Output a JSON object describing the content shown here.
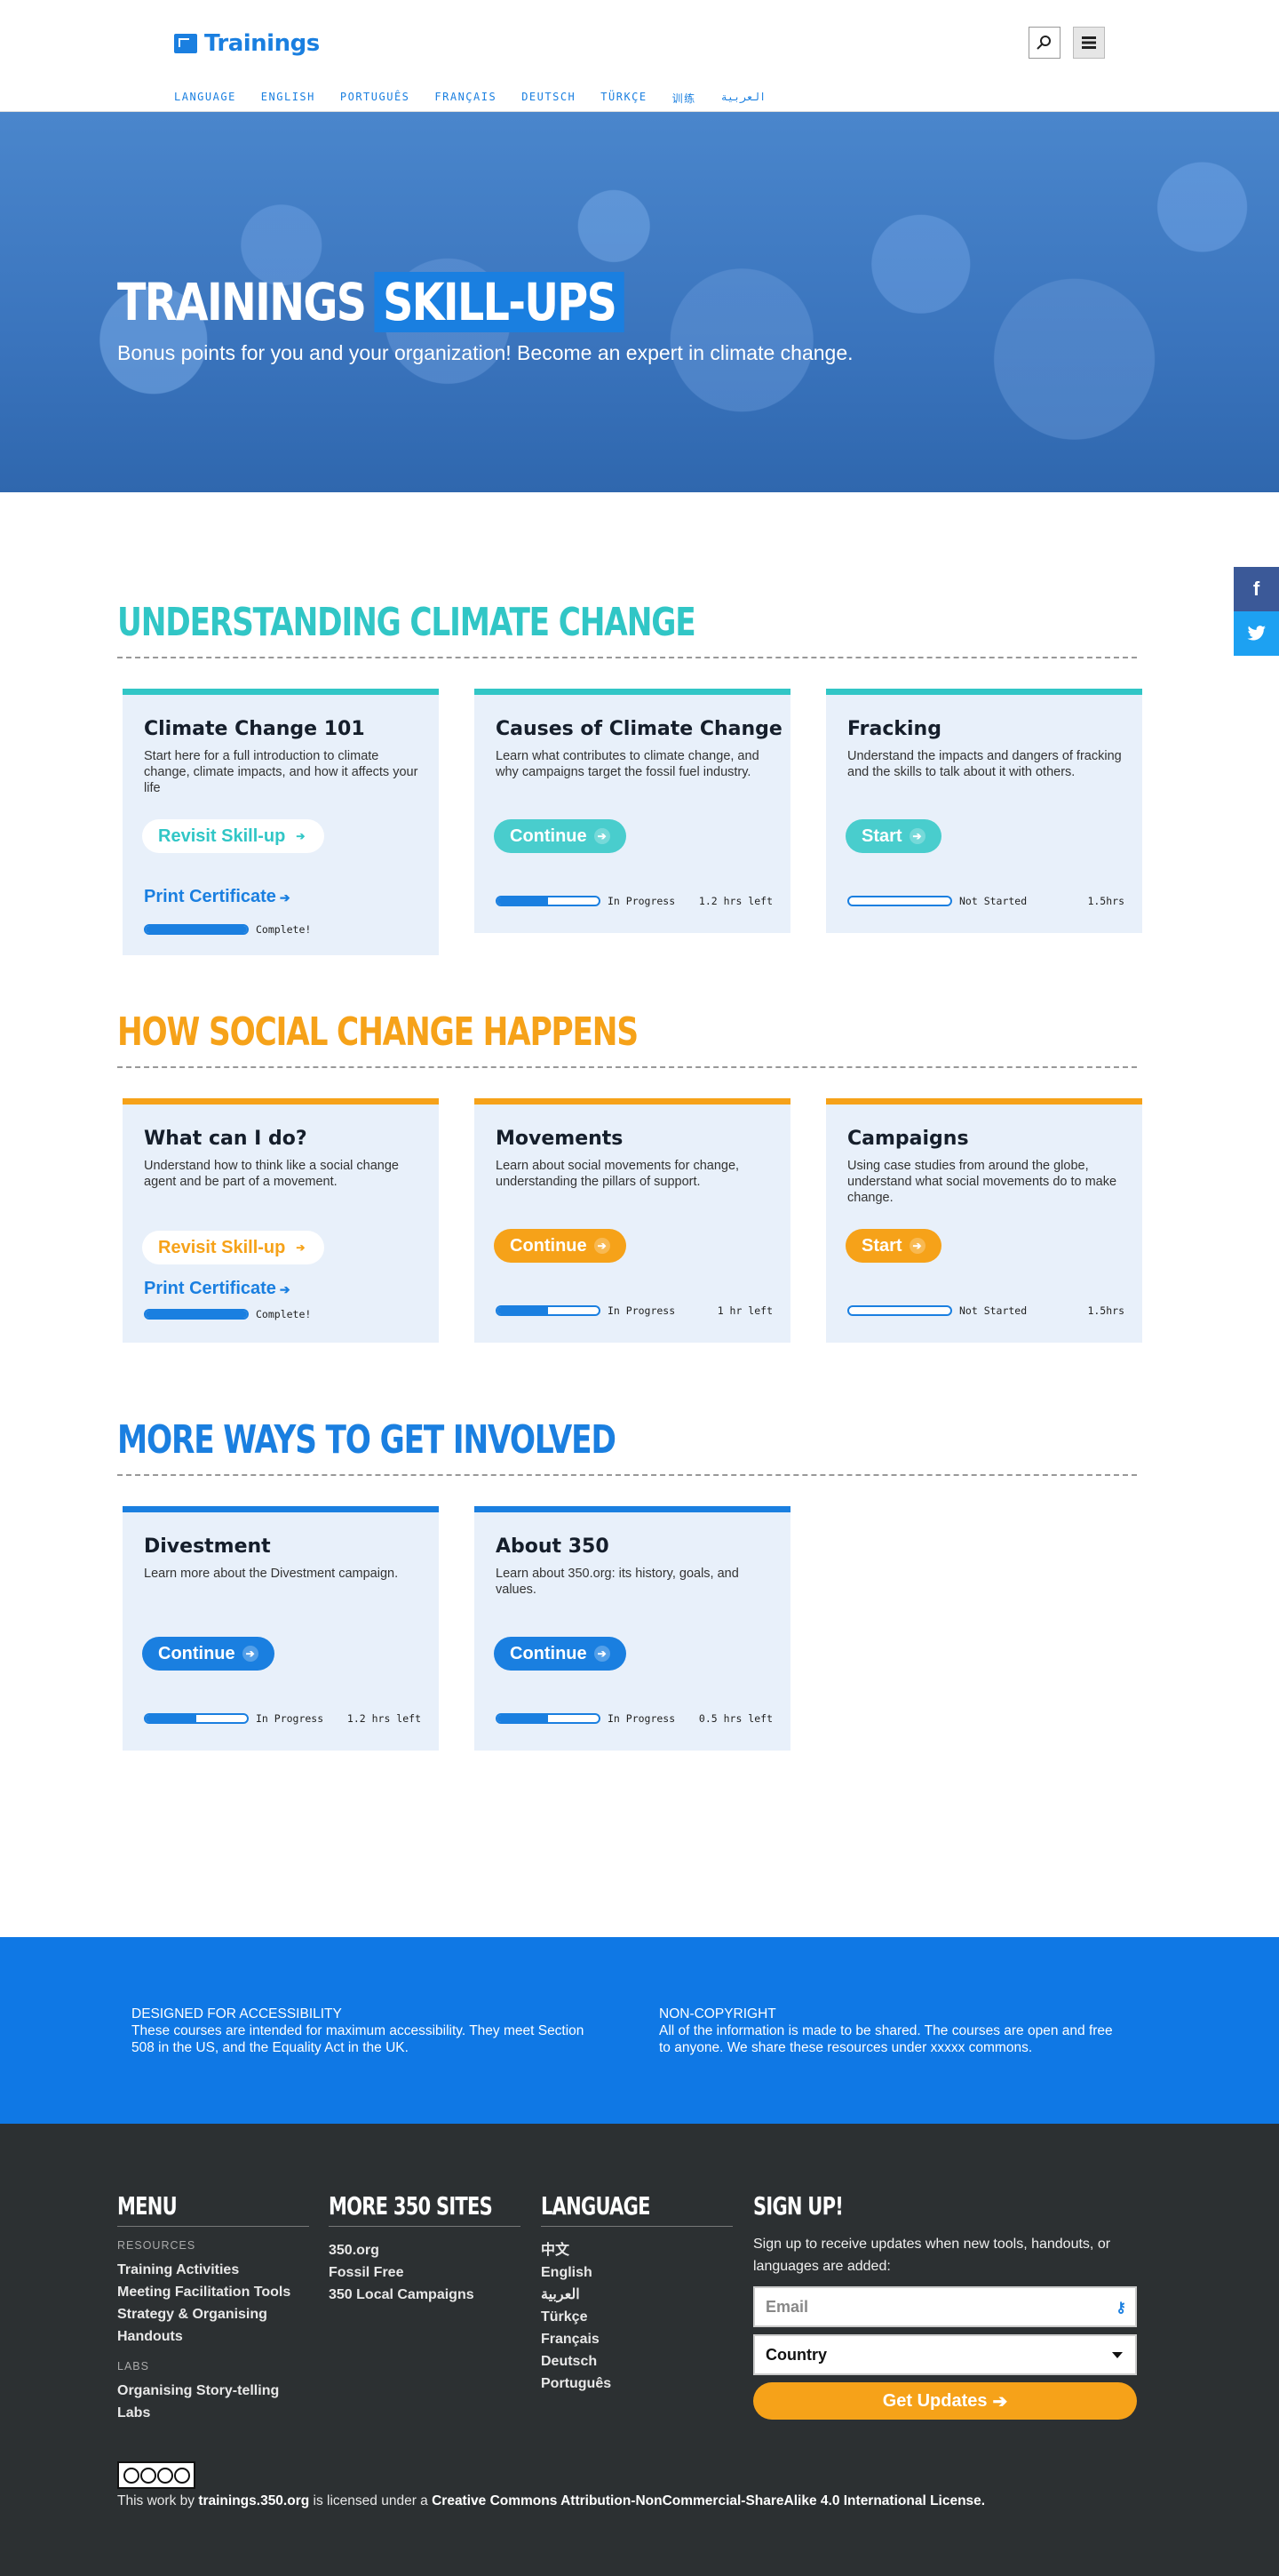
{
  "header": {
    "logo_text": "Trainings",
    "lang_items": [
      "LANGUAGE",
      "ENGLISH",
      "PORTUGUÊS",
      "FRANÇAIS",
      "DEUTSCH",
      "TÜRKÇE",
      "训练",
      "العربية"
    ]
  },
  "hero": {
    "title_plain": "TRAININGS",
    "title_highlight": "SKILL-UPS",
    "subtitle": "Bonus points for you and your organization! Become an expert in climate change."
  },
  "sections": [
    {
      "title": "UNDERSTANDING CLIMATE CHANGE",
      "cards": [
        {
          "title": "Climate Change 101",
          "desc": "Start here for a full introduction to climate change, climate impacts, and how it affects your life",
          "button": "Revisit Skill-up",
          "cert": "Print Certificate",
          "progress": 1.0,
          "status": "Complete!",
          "time": ""
        },
        {
          "title": "Causes of Climate Change",
          "desc": "Learn what contributes to climate change, and why campaigns target the fossil fuel industry.",
          "button": "Continue",
          "cert": "",
          "progress": 0.5,
          "status": "In Progress",
          "time": "1.2 hrs left"
        },
        {
          "title": "Fracking",
          "desc": "Understand the impacts and dangers of fracking and the skills to talk about it with others.",
          "button": "Start",
          "cert": "",
          "progress": 0.0,
          "status": "Not Started",
          "time": "1.5hrs"
        }
      ]
    },
    {
      "title": "HOW SOCIAL CHANGE HAPPENS",
      "cards": [
        {
          "title": "What can I do?",
          "desc": "Understand how to think like a social change agent and be part of a movement.",
          "button": "Revisit Skill-up",
          "cert": "Print Certificate",
          "progress": 1.0,
          "status": "Complete!",
          "time": ""
        },
        {
          "title": "Movements",
          "desc": "Learn about social movements for change, understanding the pillars of support.",
          "button": "Continue",
          "cert": "",
          "progress": 0.5,
          "status": "In Progress",
          "time": "1 hr left"
        },
        {
          "title": "Campaigns",
          "desc": "Using case studies from around the globe, understand what social movements do to make change.",
          "button": "Start",
          "cert": "",
          "progress": 0.0,
          "status": "Not Started",
          "time": "1.5hrs"
        }
      ]
    },
    {
      "title": "MORE WAYS TO GET INVOLVED",
      "cards": [
        {
          "title": "Divestment",
          "desc": "Learn more about the Divestment campaign.",
          "button": "Continue",
          "cert": "",
          "progress": 0.5,
          "status": "In Progress",
          "time": "1.2 hrs left"
        },
        {
          "title": "About 350",
          "desc": "Learn about 350.org: its history, goals, and values.",
          "button": "Continue",
          "cert": "",
          "progress": 0.5,
          "status": "In Progress",
          "time": "0.5 hrs left"
        }
      ]
    }
  ],
  "social": {
    "facebook": "f",
    "twitter": "t"
  },
  "band": {
    "left_heading": "DESIGNED FOR ACCESSIBILITY",
    "left_text": "These courses are intended for maximum accessibility. They meet Section 508 in the US, and the Equality Act in the UK.",
    "right_heading": "NON-COPYRIGHT",
    "right_text": "All of the information is made to be shared. The courses are open and free to anyone. We share these resources under xxxxx commons."
  },
  "footer": {
    "menu": {
      "heading": "MENU",
      "resources_label": "RESOURCES",
      "resources": [
        "Training Activities",
        "Meeting Facilitation Tools",
        "Strategy & Organising Handouts"
      ],
      "labs_label": "LABS",
      "labs": [
        "Organising Story-telling Labs"
      ]
    },
    "sites": {
      "heading": "MORE 350 SITES",
      "items": [
        "350.org",
        "Fossil Free",
        "350 Local Campaigns"
      ]
    },
    "language": {
      "heading": "LANGUAGE",
      "items": [
        "中文",
        "English",
        "العربية",
        "Türkçe",
        "Français",
        "Deutsch",
        "Português"
      ]
    },
    "signup": {
      "heading": "SIGN UP!",
      "text": "Sign up to receive updates when new tools, handouts, or languages are added:",
      "email_placeholder": "Email",
      "country_value": "Country",
      "button": "Get Updates"
    },
    "license_prefix": "This work by",
    "license_site": "trainings.350.org",
    "license_mid": "is licensed under a",
    "license_name": "Creative Commons Attribution-NonCommercial-ShareAlike 4.0 International License."
  },
  "colors": {
    "blue": "#1a7fe0",
    "teal": "#31c6c6",
    "orange": "#f6a219",
    "footer_bg": "#2c3032",
    "band_bg": "#0f78e5"
  }
}
